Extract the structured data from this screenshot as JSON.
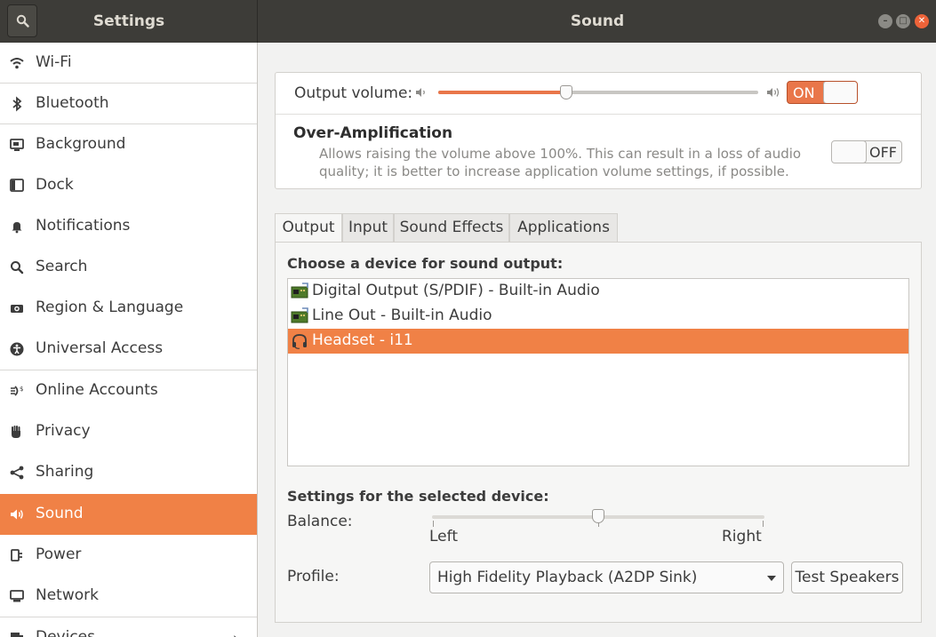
{
  "header": {
    "left_title": "Settings",
    "title": "Sound",
    "search_icon": "search-icon",
    "window_controls": [
      "minimize",
      "maximize",
      "close"
    ]
  },
  "sidebar": {
    "items": [
      {
        "label": "Wi-Fi",
        "icon": "wifi-icon"
      },
      {
        "label": "Bluetooth",
        "icon": "bluetooth-icon"
      },
      {
        "label": "Background",
        "icon": "background-icon"
      },
      {
        "label": "Dock",
        "icon": "dock-icon"
      },
      {
        "label": "Notifications",
        "icon": "bell-icon"
      },
      {
        "label": "Search",
        "icon": "search-icon"
      },
      {
        "label": "Region & Language",
        "icon": "camera-icon"
      },
      {
        "label": "Universal Access",
        "icon": "accessibility-icon"
      },
      {
        "label": "Online Accounts",
        "icon": "online-accounts-icon"
      },
      {
        "label": "Privacy",
        "icon": "hand-icon"
      },
      {
        "label": "Sharing",
        "icon": "share-icon"
      },
      {
        "label": "Sound",
        "icon": "speaker-icon",
        "selected": true
      },
      {
        "label": "Power",
        "icon": "power-icon"
      },
      {
        "label": "Network",
        "icon": "network-icon"
      },
      {
        "label": "Devices",
        "icon": "devices-icon"
      }
    ]
  },
  "output_volume": {
    "label": "Output volume:",
    "level": 0.4,
    "switch_label": "ON",
    "switch_on": true
  },
  "over_amplification": {
    "title": "Over-Amplification",
    "description": "Allows raising the volume above 100%. This can result in a loss of audio quality; it is better to increase application volume settings, if possible.",
    "switch_label": "OFF",
    "switch_on": false
  },
  "tabs": [
    {
      "label": "Output",
      "active": true
    },
    {
      "label": "Input"
    },
    {
      "label": "Sound Effects"
    },
    {
      "label": "Applications"
    }
  ],
  "output_panel": {
    "choose_label": "Choose a device for sound output:",
    "devices": [
      {
        "label": "Digital Output (S/PDIF) - Built-in Audio",
        "icon": "sound-card-icon"
      },
      {
        "label": "Line Out - Built-in Audio",
        "icon": "sound-card-icon"
      },
      {
        "label": "Headset - i11",
        "icon": "headset-icon",
        "selected": true
      }
    ],
    "settings_label": "Settings for the selected device:",
    "balance_label": "Balance:",
    "balance_left": "Left",
    "balance_right": "Right",
    "balance_level": 0.5,
    "profile_label": "Profile:",
    "profile_value": "High Fidelity Playback (A2DP Sink)",
    "test_button": "Test Speakers"
  },
  "colors": {
    "accent": "#f08146",
    "header_bg": "#3d3c38",
    "close_button": "#ed6339"
  }
}
